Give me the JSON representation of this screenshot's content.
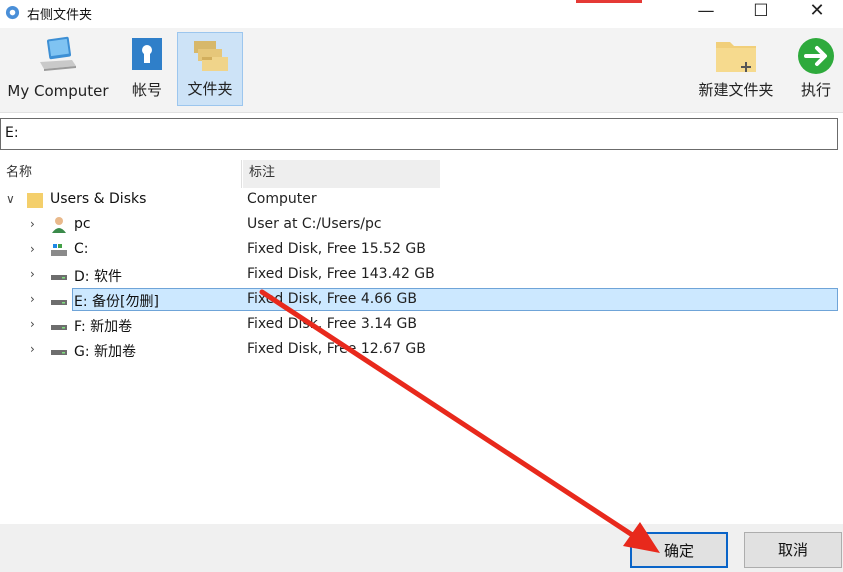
{
  "window": {
    "title": "右侧文件夹",
    "minimize": "—",
    "maximize": "☐",
    "close": "✕"
  },
  "toolbar": {
    "my_computer": "My Computer",
    "accounts": "帐号",
    "folders": "文件夹",
    "new_folder": "新建文件夹",
    "execute": "执行"
  },
  "path": {
    "value": "E:"
  },
  "columns": {
    "name": "名称",
    "note": "标注"
  },
  "tree": {
    "root": {
      "name": "Users & Disks",
      "note": "Computer"
    },
    "items": [
      {
        "name": "pc",
        "note": "User at C:/Users/pc",
        "icon": "user-icon"
      },
      {
        "name": "C:",
        "note": "Fixed Disk, Free 15.52 GB",
        "icon": "system-disk-icon"
      },
      {
        "name": "D: 软件",
        "note": "Fixed Disk, Free 143.42 GB",
        "icon": "disk-icon"
      },
      {
        "name": "E: 备份[勿删]",
        "note": "Fixed Disk, Free 4.66 GB",
        "icon": "disk-icon"
      },
      {
        "name": "F: 新加卷",
        "note": "Fixed Disk, Free 3.14 GB",
        "icon": "disk-icon"
      },
      {
        "name": "G: 新加卷",
        "note": "Fixed Disk, Free 12.67 GB",
        "icon": "disk-icon"
      }
    ]
  },
  "footer": {
    "ok": "确定",
    "cancel": "取消"
  },
  "colors": {
    "selection": "#cce8ff",
    "accent": "#0a64c8",
    "arrow": "#e8291c",
    "execute_green": "#2eaa3c"
  }
}
